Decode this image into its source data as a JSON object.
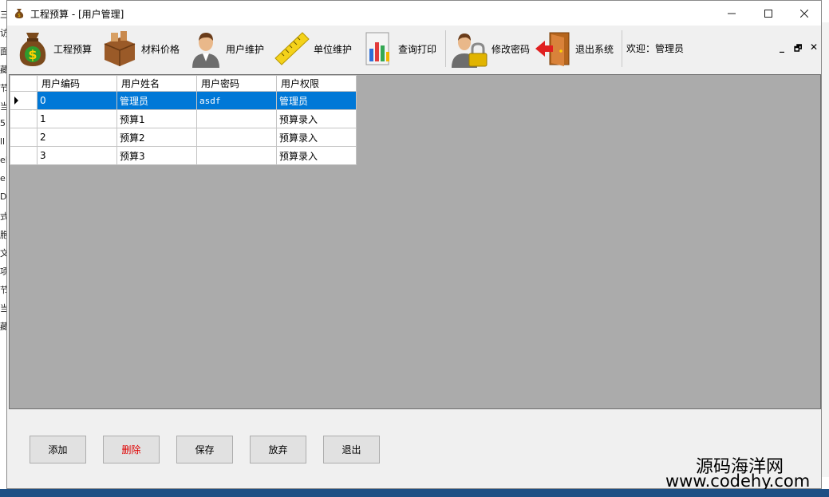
{
  "background_chars": [
    "三",
    "访",
    "面",
    "藏",
    "节",
    "当",
    "5.",
    "ll",
    "eF",
    "e",
    "D",
    "式",
    "胞",
    "文",
    "项",
    "节",
    "当",
    "藏"
  ],
  "window": {
    "title": "工程预算 - [用户管理]"
  },
  "toolbar": {
    "items": [
      {
        "label": "工程预算",
        "icon": "money-bag-icon"
      },
      {
        "label": "材料价格",
        "icon": "box-icon"
      },
      {
        "label": "用户维护",
        "icon": "user-icon"
      },
      {
        "label": "单位维护",
        "icon": "ruler-icon"
      },
      {
        "label": "查询打印",
        "icon": "chart-icon"
      },
      {
        "label": "修改密码",
        "icon": "user-lock-icon"
      },
      {
        "label": "退出系统",
        "icon": "exit-door-icon"
      }
    ],
    "welcome": "欢迎：管理员"
  },
  "grid": {
    "columns": [
      "用户编码",
      "用户姓名",
      "用户密码",
      "用户权限"
    ],
    "rows": [
      [
        "0",
        "管理员",
        "asdf",
        "管理员"
      ],
      [
        "1",
        "预算1",
        "",
        "预算录入"
      ],
      [
        "2",
        "预算2",
        "",
        "预算录入"
      ],
      [
        "3",
        "预算3",
        "",
        "预算录入"
      ]
    ],
    "selected_row": 0
  },
  "buttons": {
    "add": "添加",
    "delete": "删除",
    "save": "保存",
    "cancel": "放弃",
    "exit": "退出"
  },
  "watermark": {
    "line1": "源码海洋网",
    "line2": "www.codehy.com"
  },
  "colors": {
    "selection": "#0078d7",
    "delete_text": "#e00000",
    "grid_background": "#ababab"
  }
}
